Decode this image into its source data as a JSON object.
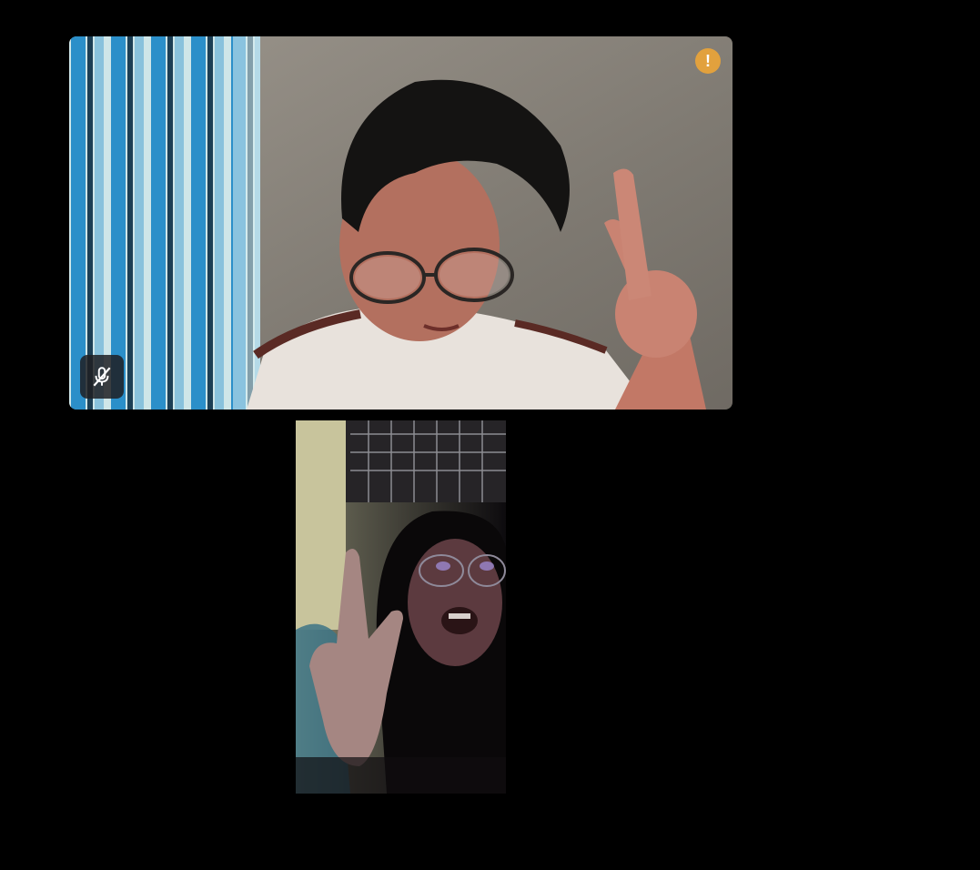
{
  "call": {
    "participants": [
      {
        "tile": "main",
        "mic_muted": true,
        "icons": {
          "mute": "mic-off-icon",
          "alert": "alert-icon"
        },
        "alert_glyph": "!"
      },
      {
        "tile": "second",
        "mic_muted": false
      }
    ]
  },
  "colors": {
    "background": "#000000",
    "alert_badge": "#e2a13d",
    "mute_indicator_bg": "#1e1e22"
  }
}
